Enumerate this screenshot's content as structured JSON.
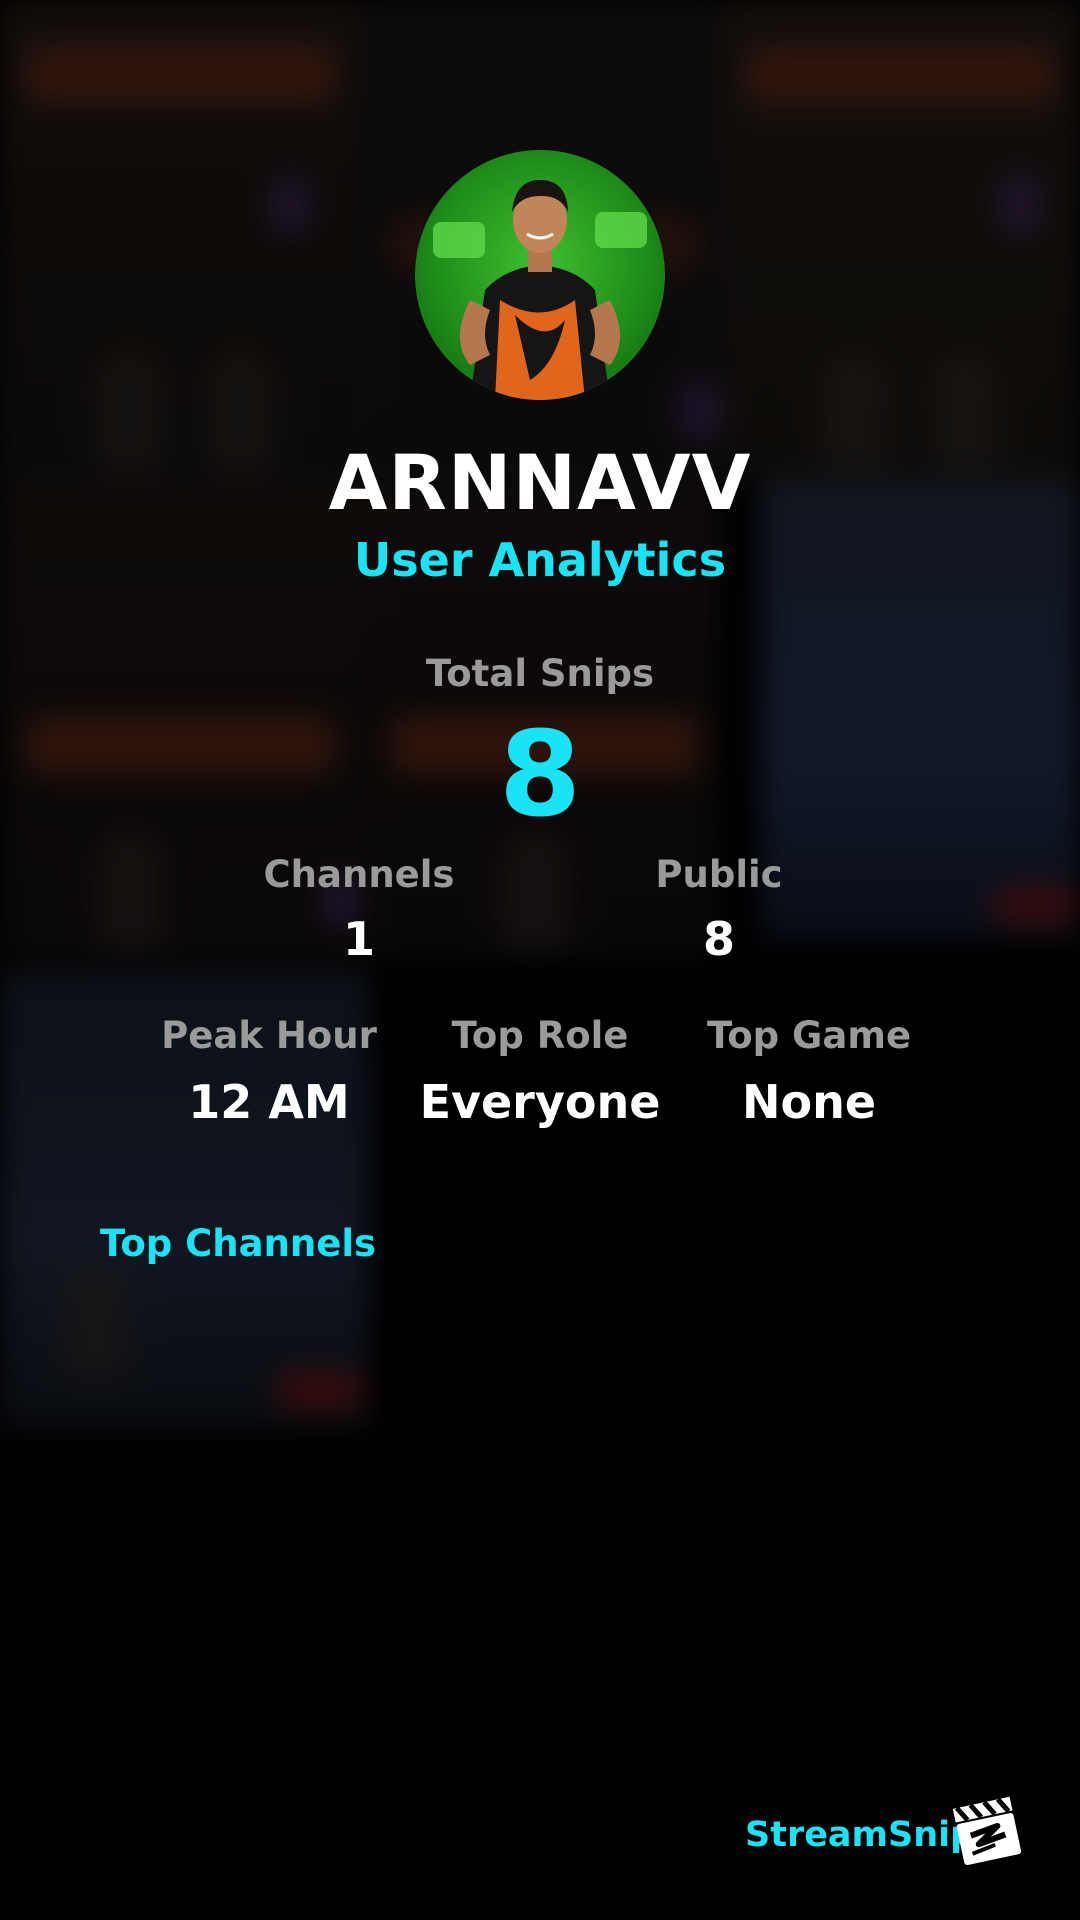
{
  "profile": {
    "username": "ARNNAVV",
    "subtitle": "User Analytics"
  },
  "stats": {
    "total_label": "Total Snips",
    "total_value": "8",
    "channels_label": "Channels",
    "channels_value": "1",
    "public_label": "Public",
    "public_value": "8",
    "peak_hour_label": "Peak Hour",
    "peak_hour_value": "12 AM",
    "top_role_label": "Top Role",
    "top_role_value": "Everyone",
    "top_game_label": "Top Game",
    "top_game_value": "None"
  },
  "top_channels": {
    "title": "Top Channels"
  },
  "footer": {
    "brand": "StreamSnip"
  },
  "colors": {
    "accent": "#19e4f5",
    "label_gray": "#9a9a9a",
    "background": "#000000"
  },
  "icons": {
    "brand_logo": "clapperboard-icon"
  }
}
